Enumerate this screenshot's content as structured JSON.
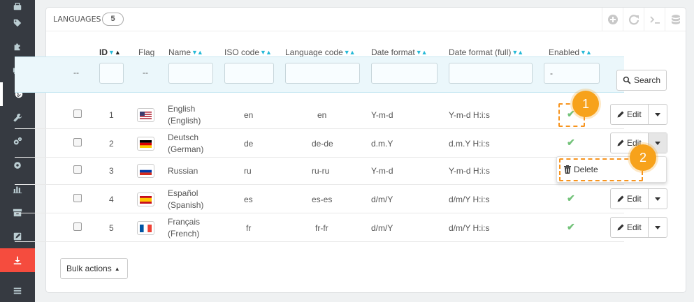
{
  "sidebar": {
    "icons": [
      "briefcase-icon",
      "tag-icon",
      "puzzle-icon",
      "truck-icon",
      "globe-icon",
      "wrench-icon",
      "gears-icon",
      "gear-icon",
      "bar-chart-icon",
      "archive-icon",
      "edit-icon",
      "download-icon",
      "menu-icon"
    ]
  },
  "panel": {
    "title": "LANGUAGES",
    "count": "5"
  },
  "toolbar": {
    "icons": [
      "add-icon",
      "refresh-icon",
      "terminal-icon",
      "database-icon"
    ]
  },
  "columns": {
    "id": "ID",
    "flag": "Flag",
    "name": "Name",
    "iso": "ISO code",
    "lang_code": "Language code",
    "date": "Date format",
    "date_full": "Date format (full)",
    "enabled": "Enabled"
  },
  "sort_glyphs": {
    "asc": "▲",
    "desc": "▼",
    "both": "▼▲"
  },
  "filters": {
    "left_dash": "--",
    "flag_dash": "--",
    "enabled_value": "-",
    "search_label": "Search"
  },
  "rows": [
    {
      "id": "1",
      "name_line1": "English",
      "name_line2": "(English)",
      "iso": "en",
      "lang_code": "en",
      "date": "Y-m-d",
      "date_full": "Y-m-d H:i:s",
      "enabled": "✔",
      "flag": "us"
    },
    {
      "id": "2",
      "name_line1": "Deutsch",
      "name_line2": "(German)",
      "iso": "de",
      "lang_code": "de-de",
      "date": "d.m.Y",
      "date_full": "d.m.Y H:i:s",
      "enabled": "✔",
      "flag": "de"
    },
    {
      "id": "3",
      "name_line1": "Russian",
      "name_line2": "",
      "iso": "ru",
      "lang_code": "ru-ru",
      "date": "Y-m-d",
      "date_full": "Y-m-d H:i:s",
      "enabled": "",
      "flag": "ru"
    },
    {
      "id": "4",
      "name_line1": "Español",
      "name_line2": "(Spanish)",
      "iso": "es",
      "lang_code": "es-es",
      "date": "d/m/Y",
      "date_full": "d/m/Y H:i:s",
      "enabled": "✔",
      "flag": "es"
    },
    {
      "id": "5",
      "name_line1": "Français",
      "name_line2": "(French)",
      "iso": "fr",
      "lang_code": "fr-fr",
      "date": "d/m/Y",
      "date_full": "d/m/Y H:i:s",
      "enabled": "✔",
      "flag": "fr"
    }
  ],
  "actions": {
    "edit_label": "Edit",
    "delete_label": "Delete",
    "bulk_label": "Bulk actions",
    "bulk_caret": "▲"
  },
  "callouts": {
    "one": "1",
    "two": "2"
  },
  "colors": {
    "accent": "#25b9d7",
    "enabled_green": "#72c279",
    "callout_orange": "#f7a21b",
    "sidebar_bg": "#363a41",
    "sidebar_highlight": "#f54c3e"
  }
}
